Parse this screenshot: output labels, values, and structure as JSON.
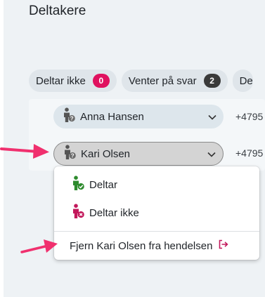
{
  "page": {
    "title": "Deltakere"
  },
  "filters": [
    {
      "label": "Deltar ikke",
      "count": "0",
      "color": "#e0115f"
    },
    {
      "label": "Venter på svar",
      "count": "2",
      "color": "#3a3a3a"
    },
    {
      "label": "De",
      "count": "",
      "color": ""
    }
  ],
  "participants": [
    {
      "name": "Anna Hansen",
      "phone": "+4795",
      "icon": "person-unknown-icon"
    },
    {
      "name": "Kari Olsen",
      "phone": "+4795",
      "icon": "person-unknown-icon"
    }
  ],
  "menu": {
    "items": [
      {
        "label": "Deltar",
        "icon": "person-check-icon",
        "color": "#2e8b2e"
      },
      {
        "label": "Deltar ikke",
        "icon": "person-x-icon",
        "color": "#c2185b"
      }
    ],
    "remove_label": "Fjern Kari Olsen fra hendelsen",
    "remove_icon": "sign-out-icon"
  },
  "colors": {
    "annotation_arrow": "#f0306e",
    "accent": "#e0115f"
  }
}
